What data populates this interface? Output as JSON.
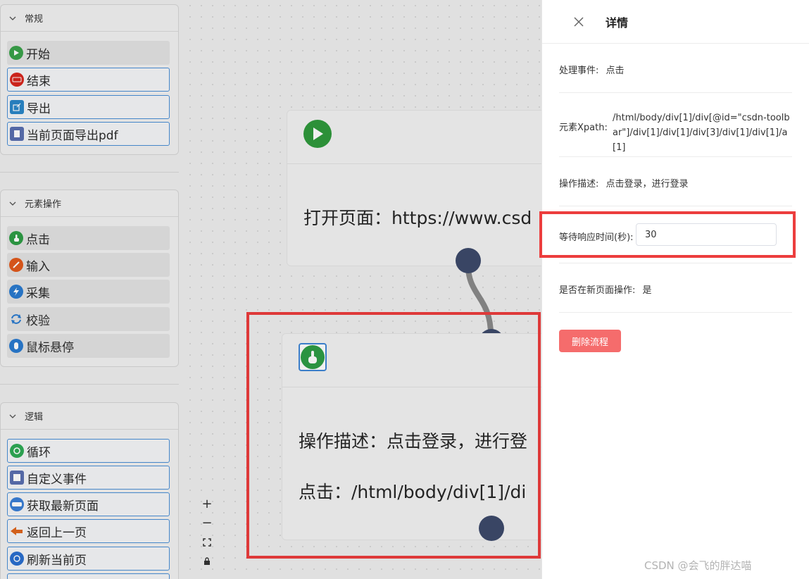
{
  "sidebar": {
    "groups": [
      {
        "title": "常规",
        "items": [
          {
            "label": "开始",
            "icon": "play-icon",
            "color": "#3aa24a"
          },
          {
            "label": "结束",
            "icon": "end-icon",
            "color": "#d8261d"
          },
          {
            "label": "导出",
            "icon": "export-icon",
            "color": "#2a86c8"
          },
          {
            "label": "当前页面导出pdf",
            "icon": "pdf-icon",
            "color": "#5a6fb0"
          }
        ]
      },
      {
        "title": "元素操作",
        "items": [
          {
            "label": "点击",
            "icon": "hand-pointer-icon",
            "color": "#2e9d46"
          },
          {
            "label": "输入",
            "icon": "pencil-icon",
            "color": "#e25a1c"
          },
          {
            "label": "采集",
            "icon": "lightning-icon",
            "color": "#2a7bd0"
          },
          {
            "label": "校验",
            "icon": "sync-icon",
            "color": "#2a7bd0"
          },
          {
            "label": "鼠标悬停",
            "icon": "mouse-hover-icon",
            "color": "#2a7bd0"
          }
        ]
      },
      {
        "title": "逻辑",
        "items": [
          {
            "label": "循环",
            "icon": "loop-icon",
            "color": "#2eaa55"
          },
          {
            "label": "自定义事件",
            "icon": "custom-event-icon",
            "color": "#5a6fb0"
          },
          {
            "label": "获取最新页面",
            "icon": "new-badge-icon",
            "color": "#3a7fd6"
          },
          {
            "label": "返回上一页",
            "icon": "back-arrow-icon",
            "color": "#e0661d"
          },
          {
            "label": "刷新当前页",
            "icon": "refresh-icon",
            "color": "#2a6fd0"
          }
        ]
      }
    ]
  },
  "canvas": {
    "node1": {
      "text": "打开页面：https://www.csd"
    },
    "node2": {
      "line1": "操作描述：点击登录，进行登",
      "line2": "点击：/html/body/div[1]/di"
    },
    "zoom": [
      "+",
      "−",
      "⛶",
      "🔒"
    ]
  },
  "drawer": {
    "title": "详情",
    "rows": {
      "event_label": "处理事件:",
      "event_value": "点击",
      "xpath_label": "元素Xpath:",
      "xpath_value": "/html/body/div[1]/div[@id=\"csdn-toolbar\"]/div[1]/div[1]/div[3]/div[1]/div[1]/a[1]",
      "desc_label": "操作描述:",
      "desc_value": "点击登录，进行登录",
      "wait_label": "等待响应时间(秒):",
      "wait_value": "30",
      "newpage_label": "是否在新页面操作:",
      "newpage_value": "是"
    },
    "delete_label": "删除流程"
  },
  "watermark": "CSDN @会飞的胖达喵",
  "colors": {
    "accent_red": "#ec3d3d",
    "danger": "#f56c6c",
    "handle": "#3d4a6b"
  }
}
